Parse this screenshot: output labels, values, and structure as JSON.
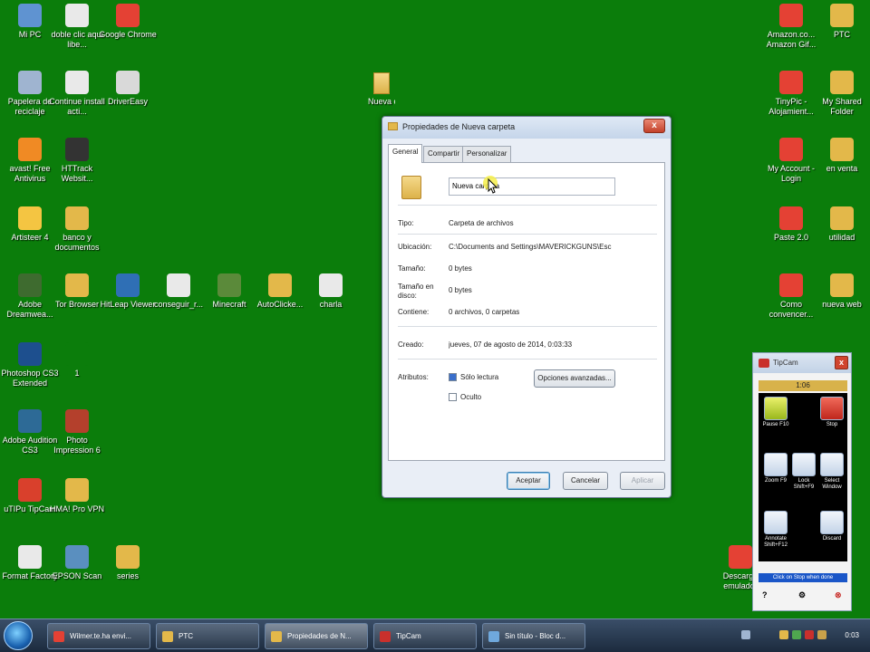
{
  "desktop": {
    "left_icons": [
      {
        "label": "Mi PC"
      },
      {
        "label": "doble clic aqui libe..."
      },
      {
        "label": "Google Chrome"
      },
      {
        "label": "Papelera de reciclaje"
      },
      {
        "label": "Continue install acti..."
      },
      {
        "label": "DriverEasy"
      },
      {
        "label": "avast! Free Antivirus"
      },
      {
        "label": "HTTrack Websit..."
      },
      {
        "label": "Artisteer 4"
      },
      {
        "label": "banco y documentos"
      },
      {
        "label": "Adobe Dreamwea..."
      },
      {
        "label": "Tor Browser"
      },
      {
        "label": "HitLeap Viewer"
      },
      {
        "label": "conseguir_r..."
      },
      {
        "label": "Minecraft"
      },
      {
        "label": "AutoClicke..."
      },
      {
        "label": "charla"
      },
      {
        "label": "Photoshop CS3 Extended"
      },
      {
        "label": "1"
      },
      {
        "label": "Adobe Audition CS3"
      },
      {
        "label": "Photo Impression 6"
      },
      {
        "label": "uTIPu TipCam"
      },
      {
        "label": "HMA! Pro VPN"
      },
      {
        "label": "Format Factory"
      },
      {
        "label": "EPSON Scan"
      },
      {
        "label": "series"
      }
    ],
    "middle_icon": {
      "label": "Nueva carpeta"
    },
    "right_icons": [
      {
        "label": "Amazon.co... Amazon Gif..."
      },
      {
        "label": "PTC"
      },
      {
        "label": "TinyPic - Alojamient..."
      },
      {
        "label": "My Shared Folder"
      },
      {
        "label": "My Account - Login"
      },
      {
        "label": "en venta"
      },
      {
        "label": "Paste 2.0"
      },
      {
        "label": "utilidad"
      },
      {
        "label": "Como convencer..."
      },
      {
        "label": "nueva web"
      },
      {
        "label": "Descarga emulador"
      }
    ]
  },
  "dialog": {
    "title": "Propiedades de Nueva carpeta",
    "close_label": "x",
    "tabs": [
      "General",
      "Compartir",
      "Personalizar"
    ],
    "name_value": "Nueva carpeta",
    "rows": [
      {
        "label": "Tipo:",
        "value": "Carpeta de archivos"
      },
      {
        "label": "Ubicación:",
        "value": "C:\\Documents and Settings\\MAVERICKGUNS\\Esc"
      },
      {
        "label": "Tamaño:",
        "value": "0 bytes"
      },
      {
        "label": "Tamaño en disco:",
        "value": "0 bytes"
      },
      {
        "label": "Contiene:",
        "value": "0 archivos, 0 carpetas"
      },
      {
        "label": "Creado:",
        "value": "jueves, 07 de agosto de 2014, 0:03:33"
      }
    ],
    "attributes_label": "Atributos:",
    "readonly_label": "Sólo lectura",
    "hidden_label": "Oculto",
    "advanced_button": "Opciones avanzadas...",
    "ok_button": "Aceptar",
    "cancel_button": "Cancelar",
    "apply_button": "Aplicar"
  },
  "tipcam": {
    "title": "TipCam",
    "close_label": "x",
    "timer": "1:06",
    "buttons": [
      {
        "label": "Pause F10"
      },
      {
        "label": "Stop"
      },
      {
        "label": "Zoom F9"
      },
      {
        "label": "Lock Shift+F9"
      },
      {
        "label": "Select Window"
      },
      {
        "label": "Annotate Shift+F12"
      },
      {
        "label": "Discard"
      }
    ],
    "hint": "Click on Stop when done",
    "footer": [
      "?",
      "⚙",
      "⊗"
    ]
  },
  "taskbar": {
    "tasks": [
      {
        "label": "Wilmer.te.ha envi...",
        "color": "#e44134"
      },
      {
        "label": "PTC",
        "color": "#e3b84a"
      },
      {
        "label": "Propiedades de N...",
        "color": "#e3b84a"
      },
      {
        "label": "TipCam",
        "color": "#c9302c"
      },
      {
        "label": "Sin título - Bloc d...",
        "color": "#6fa8dc"
      }
    ],
    "clock": "0:03"
  }
}
